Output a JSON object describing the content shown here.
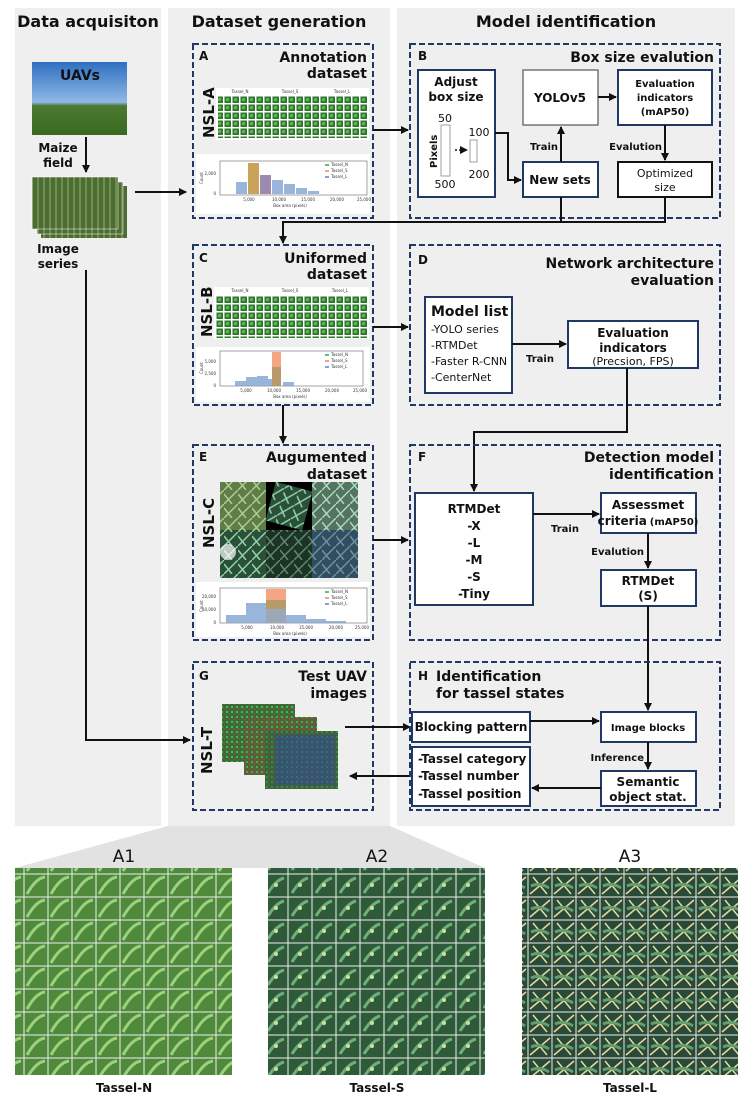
{
  "columns": {
    "acquisition": "Data acquisiton",
    "generation": "Dataset generation",
    "identification": "Model identification"
  },
  "acquisition": {
    "uav_label": "UAVs",
    "field_label": "Maize field",
    "field_line1": "Maize",
    "field_line2": "field",
    "series_line1": "Image",
    "series_line2": "series"
  },
  "panel_a": {
    "letter": "A",
    "title1": "Annotation",
    "title2": "dataset",
    "nsl": "NSL-A",
    "classes": [
      "Tassel_N",
      "Tassel_S",
      "Tassel_L"
    ],
    "y_label": "Count",
    "x_label": "Box area (pixels)",
    "x_ticks": [
      "5,000",
      "10,000",
      "15,000",
      "20,000",
      "25,000"
    ],
    "y_ticks": [
      "0",
      "2,000"
    ]
  },
  "panel_b": {
    "letter": "B",
    "title": "Box size evalution",
    "adjust1": "Adjust",
    "adjust2": "box size",
    "pixels": "Pixels",
    "scale1_top": "50",
    "scale1_bottom": "500",
    "scale2_top": "100",
    "scale2_bottom": "200",
    "yolo": "YOLOv5",
    "eval1": "Evaluation",
    "eval2": "indicators",
    "eval3": "(mAP50)",
    "train": "Train",
    "evalution": "Evalution",
    "new_sets": "New sets",
    "opt1": "Optimized",
    "opt2": "size"
  },
  "panel_c": {
    "letter": "C",
    "title1": "Uniformed",
    "title2": "dataset",
    "nsl": "NSL-B",
    "classes": [
      "Tassel_N",
      "Tassel_S",
      "Tassel_L"
    ],
    "y_label": "Count",
    "x_label": "Box area (pixels)",
    "x_ticks": [
      "5,000",
      "10,000",
      "15,000",
      "20,000",
      "25,000"
    ],
    "y_ticks": [
      "0",
      "2,500",
      "5,000"
    ]
  },
  "panel_d": {
    "letter": "D",
    "title1": "Network architecture",
    "title2": "evaluation",
    "model_list": "Model list",
    "models": [
      "-YOLO series",
      "-RTMDet",
      "-Faster R-CNN",
      "-CenterNet"
    ],
    "train": "Train",
    "eval1": "Evaluation",
    "eval2": "indicators",
    "eval3": "(Precsion,  FPS)"
  },
  "panel_e": {
    "letter": "E",
    "title1": "Augumented",
    "title2": "dataset",
    "nsl": "NSL-C",
    "classes": [
      "Tassel_N",
      "Tassel_S",
      "Tassel_L"
    ],
    "y_label": "Count",
    "x_label": "Box area (pixels)",
    "x_ticks": [
      "5,000",
      "10,000",
      "15,000",
      "20,000",
      "25,000"
    ],
    "y_ticks": [
      "0",
      "10,000",
      "20,000"
    ]
  },
  "panel_f": {
    "letter": "F",
    "title1": "Detection model",
    "title2": "identification",
    "rtmdet": "RTMDet",
    "variants": [
      "-X",
      "-L",
      "-M",
      "-S",
      "-Tiny"
    ],
    "train": "Train",
    "assess1": "Assessmet",
    "assess2": "criteria",
    "assess3": "(mAP50)",
    "evalution": "Evalution",
    "result1": "RTMDet",
    "result2": "(S)"
  },
  "panel_g": {
    "letter": "G",
    "title1": "Test UAV",
    "title2": "images",
    "nsl": "NSL-T"
  },
  "panel_h": {
    "letter": "H",
    "title1": "Identification",
    "title2": "for tassel states",
    "blocking": "Blocking pattern",
    "image_blocks": "Image blocks",
    "inference": "Inference",
    "semantic1": "Semantic",
    "semantic2": "object stat.",
    "outputs": [
      "-Tassel category",
      "-Tassel number",
      "-Tassel position"
    ]
  },
  "samples": [
    {
      "id": "A1",
      "label": "Tassel-N"
    },
    {
      "id": "A2",
      "label": "Tassel-S"
    },
    {
      "id": "A3",
      "label": "Tassel-L"
    }
  ],
  "colors": {
    "box_border": "#1f3864",
    "column_bg": "#efefef",
    "tassel_n": "#5cc08a",
    "tassel_s": "#f4a582",
    "tassel_l": "#7fa3d0"
  }
}
